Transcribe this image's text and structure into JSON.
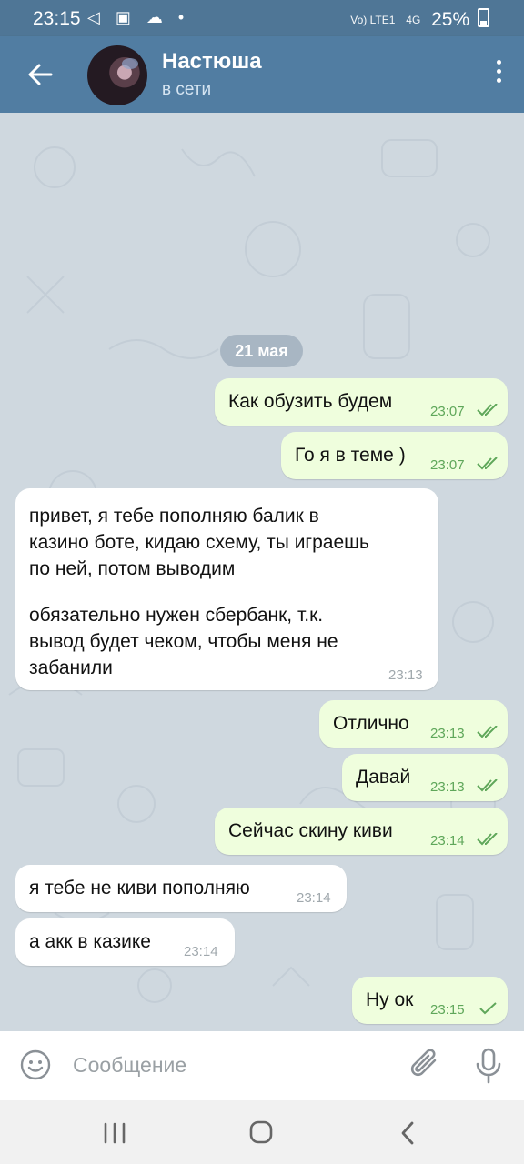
{
  "status_bar": {
    "time": "23:15",
    "left_icons": "◁ ▣ ☁ •",
    "network_label": "Vo) LTE1",
    "network_label2": "4G",
    "battery": "25%"
  },
  "header": {
    "contact_name": "Настюша",
    "status": "в сети"
  },
  "date_separator": "21 мая",
  "messages": [
    {
      "text": "Как обузить будем",
      "time": "23:07"
    },
    {
      "text": "Го я в теме )",
      "time": "23:07"
    },
    {
      "text_line1": "привет, я тебе пополняю балик в",
      "text_line2": "казино боте, кидаю схему, ты играешь",
      "text_line3": "по ней, потом выводим",
      "text_line4": "обязательно нужен сбербанк, т.к.",
      "text_line5": "вывод будет чеком, чтобы меня не",
      "text_line6": "забанили",
      "time": "23:13"
    },
    {
      "text": "Отлично",
      "time": "23:13"
    },
    {
      "text": "Давай",
      "time": "23:13"
    },
    {
      "text": "Сейчас скину киви",
      "time": "23:14"
    },
    {
      "text": "я тебе не киви пополняю",
      "time": "23:14"
    },
    {
      "text": "а акк в казике",
      "time": "23:14"
    },
    {
      "text": "Ну ок",
      "time": "23:15"
    }
  ],
  "input": {
    "placeholder": "Сообщение"
  },
  "icons": {
    "back": "arrow-left-icon",
    "menu": "more-vert-icon",
    "emoji": "smile-icon",
    "attach": "paperclip-icon",
    "mic": "microphone-icon"
  },
  "colors": {
    "header": "#517da2",
    "outgoing_bubble": "#effedd",
    "incoming_bubble": "#ffffff",
    "read_check": "#5fa75a"
  }
}
